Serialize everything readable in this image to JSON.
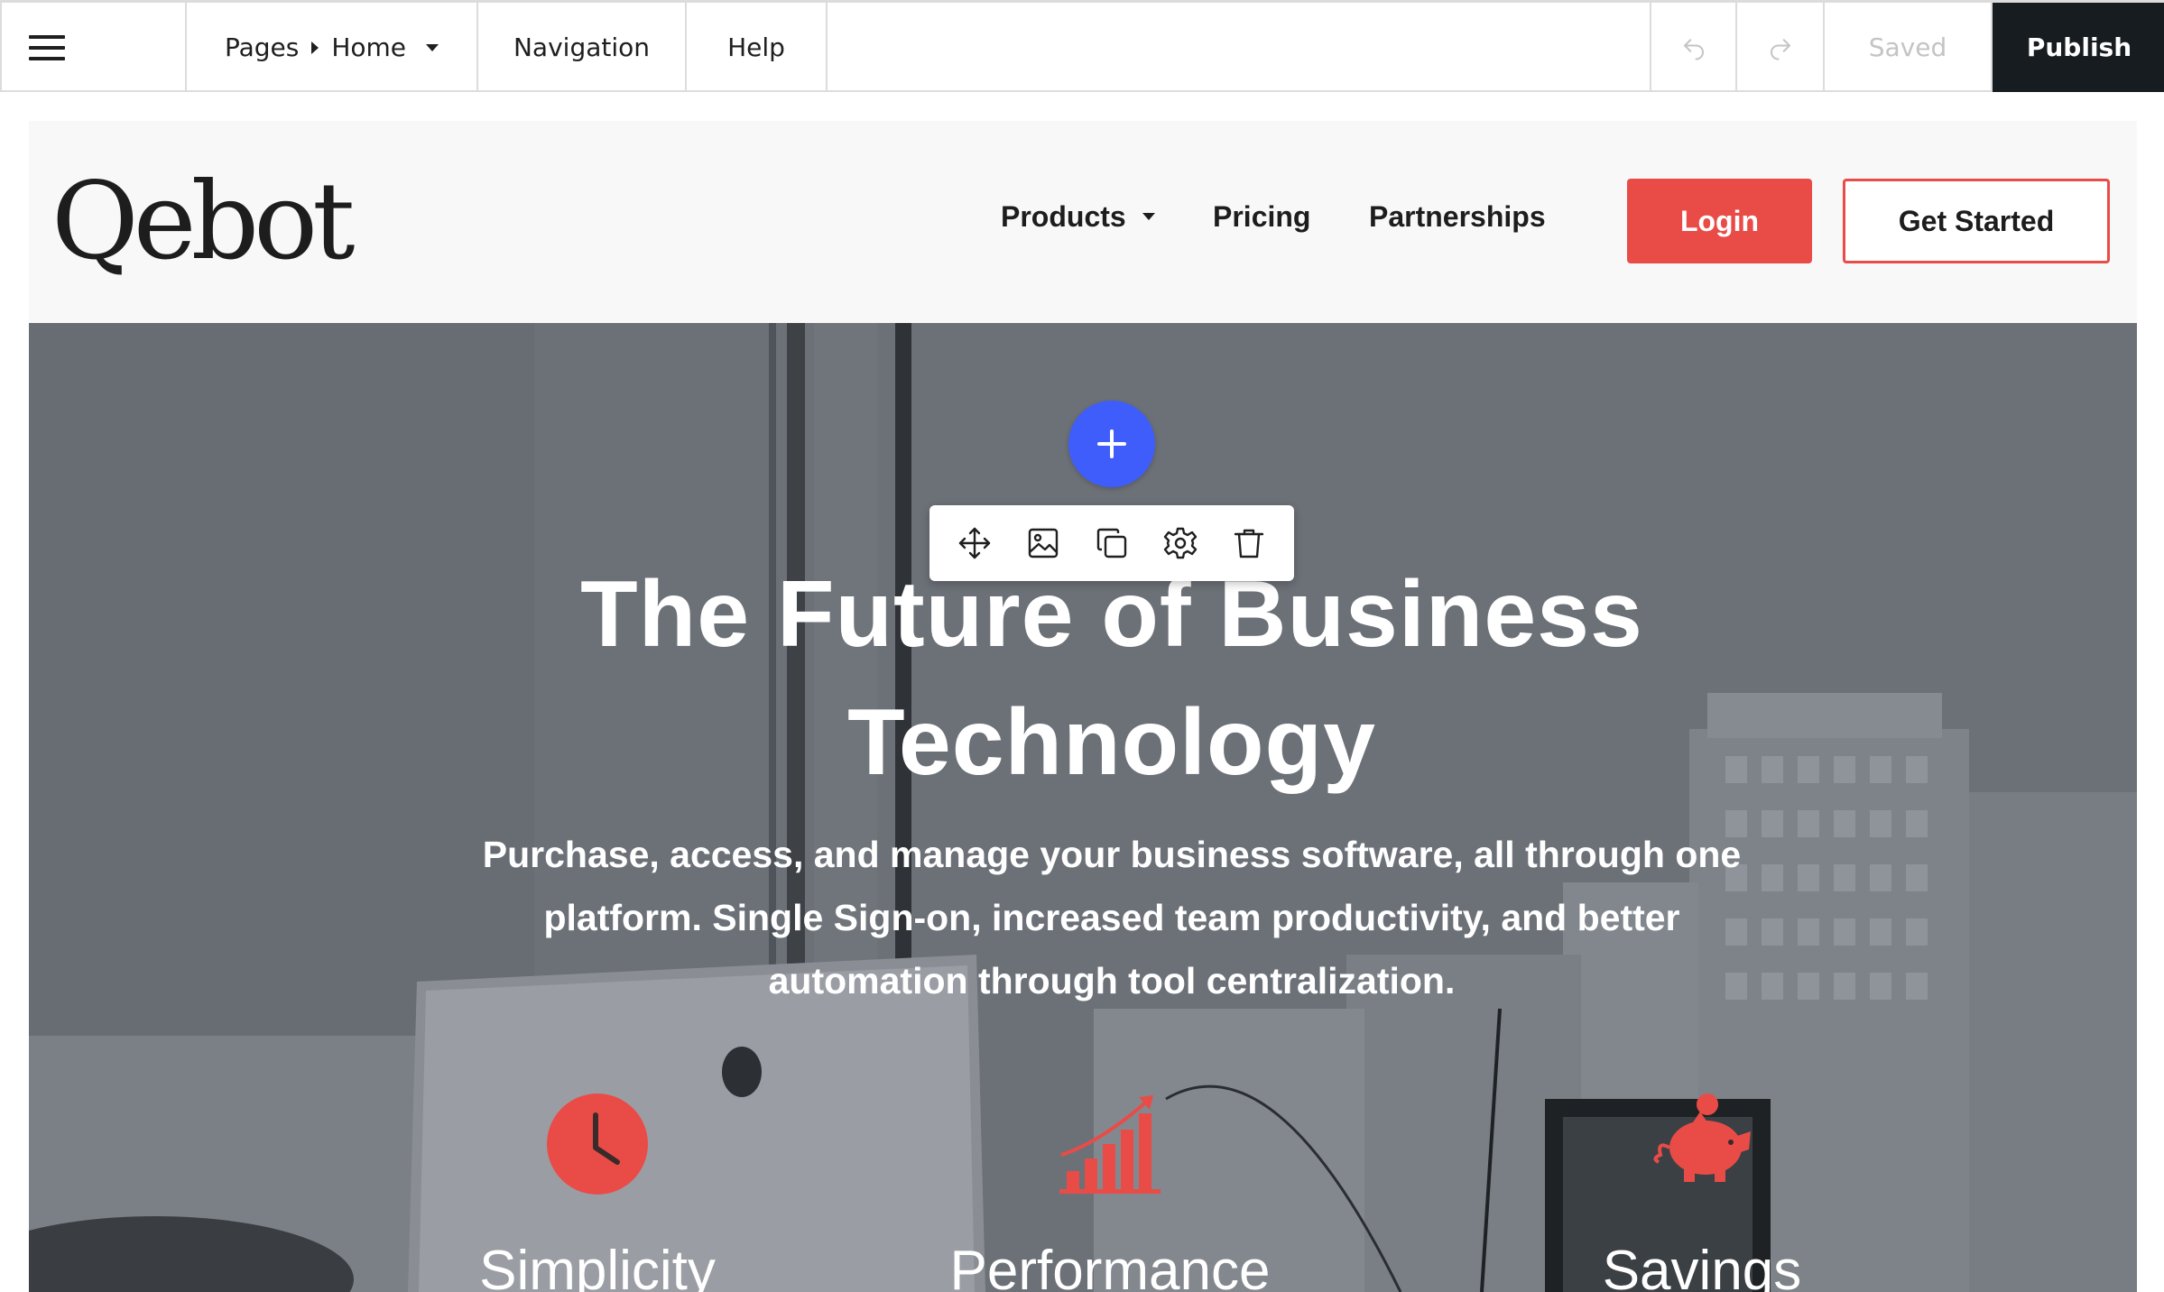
{
  "editor": {
    "pages_label": "Pages",
    "current_page": "Home",
    "navigation_label": "Navigation",
    "help_label": "Help",
    "saved_label": "Saved",
    "publish_label": "Publish"
  },
  "site": {
    "logo_text": "Qebot",
    "nav": {
      "products": "Products",
      "pricing": "Pricing",
      "partnerships": "Partnerships"
    },
    "login_label": "Login",
    "get_started_label": "Get Started",
    "hero": {
      "title_line1": "The Future of Business",
      "title_line2": "Technology",
      "subtitle_line1": "Purchase, access, and manage your business software, all through one",
      "subtitle_line2": "platform. Single Sign-on, increased team productivity, and better",
      "subtitle_line3": "automation through tool centralization."
    },
    "features": [
      {
        "label": "Simplicity",
        "icon": "clock-icon"
      },
      {
        "label": "Performance",
        "icon": "growth-chart-icon"
      },
      {
        "label": "Savings",
        "icon": "piggy-bank-icon"
      }
    ]
  },
  "block_toolbar": {
    "tools": [
      "move-icon",
      "image-icon",
      "duplicate-icon",
      "settings-icon",
      "delete-icon"
    ]
  },
  "colors": {
    "accent_red": "#e94c47",
    "add_button_blue": "#3f5dfb",
    "publish_bg": "#171c21",
    "hero_overlay": "#6f747b"
  }
}
